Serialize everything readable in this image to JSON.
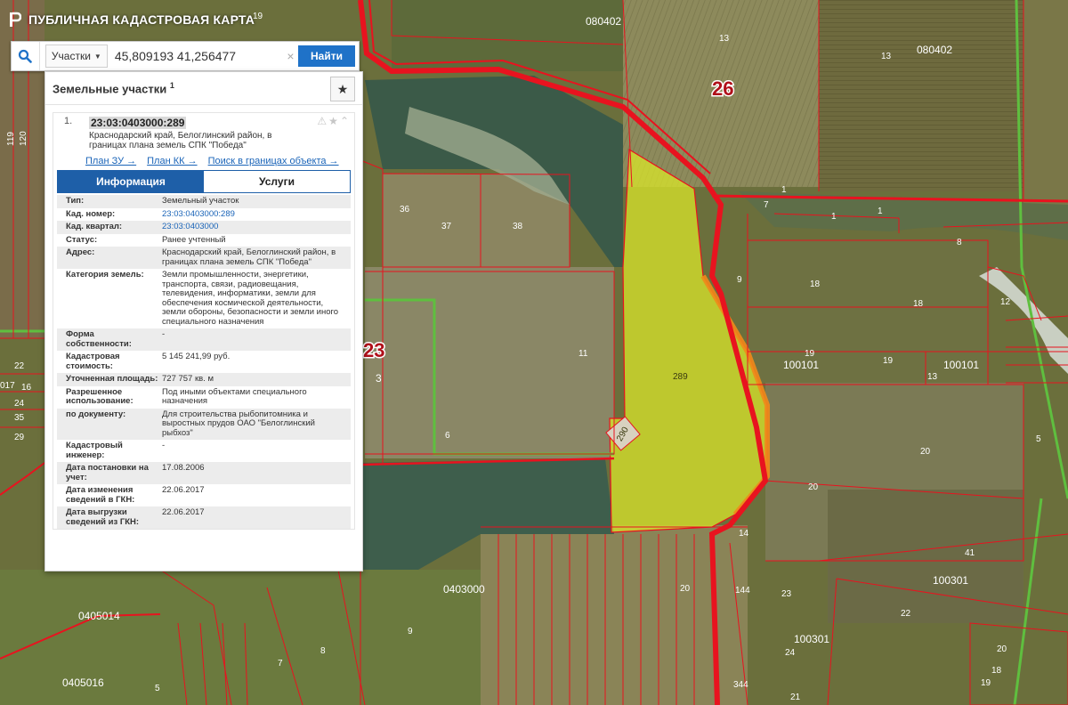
{
  "app": {
    "title": "ПУБЛИЧНАЯ КАДАСТРОВАЯ КАРТА"
  },
  "search": {
    "type_label": "Участки",
    "value": "45,809193 41,256477",
    "clear_symbol": "×",
    "button_label": "Найти"
  },
  "panel": {
    "title": "Земельные участки",
    "count": "1",
    "fav_symbol": "★",
    "result": {
      "index": "1.",
      "cad_number": "23:03:0403000:289",
      "address": "Краснодарский край, Белоглинский район, в границах плана земель СПК \"Победа\"",
      "icons": "⚠★⌃",
      "links": [
        "План ЗУ →",
        "План КК →",
        "Поиск в границах объекта →"
      ]
    },
    "tabs": [
      {
        "label": "Информация",
        "active": true
      },
      {
        "label": "Услуги",
        "active": false
      }
    ],
    "rows": [
      {
        "key": "Тип:",
        "value": "Земельный участок",
        "link": false
      },
      {
        "key": "Кад. номер:",
        "value": "23:03:0403000:289",
        "link": true
      },
      {
        "key": "Кад. квартал:",
        "value": "23:03:0403000",
        "link": true
      },
      {
        "key": "Статус:",
        "value": "Ранее учтенный",
        "link": false
      },
      {
        "key": "Адрес:",
        "value": "Краснодарский край, Белоглинский район, в границах плана земель СПК \"Победа\"",
        "link": false
      },
      {
        "key": "Категория земель:",
        "value": "Земли промышленности, энергетики, транспорта, связи, радиовещания, телевидения, информатики, земли для обеспечения космической деятельности, земли обороны, безопасности и земли иного специального назначения",
        "link": false
      },
      {
        "key": "Форма собственности:",
        "value": "-",
        "link": false
      },
      {
        "key": "Кадастровая стоимость:",
        "value": "5 145 241,99 руб.",
        "link": false
      },
      {
        "key": "Уточненная площадь:",
        "value": "727 757 кв. м",
        "link": false
      },
      {
        "key": "Разрешенное использование:",
        "value": "Под иными объектами специального назначения",
        "link": false
      },
      {
        "key": "по документу:",
        "value": "Для строительства рыбопитомника и выростных прудов ОАО \"Белоглинский рыбхоз\"",
        "link": false
      },
      {
        "key": "Кадастровый инженер:",
        "value": "-",
        "link": false
      },
      {
        "key": "Дата постановки на учет:",
        "value": "17.08.2006",
        "link": false
      },
      {
        "key": "Дата изменения сведений в ГКН:",
        "value": "22.06.2017",
        "link": false
      },
      {
        "key": "Дата выгрузки сведений из ГКН:",
        "value": "22.06.2017",
        "link": false
      }
    ]
  },
  "map": {
    "labels": {
      "l_19": "19",
      "l_080402a": "080402",
      "l_13a": "13",
      "l_13b": "13",
      "l_080402b": "080402",
      "l_26": "26",
      "l_36": "36",
      "l_37": "37",
      "l_38": "38",
      "l_1a": "1",
      "l_1b": "1",
      "l_1c": "1",
      "l_7": "7",
      "l_8": "8",
      "l_9": "9",
      "l_18a": "18",
      "l_18b": "18",
      "l_12": "12",
      "l_19b": "19",
      "l_19c": "19",
      "l_100101a": "100101",
      "l_100101b": "100101",
      "l_13c": "13",
      "l_23": "23",
      "l_3": "3",
      "l_11": "11",
      "l_289": "289",
      "l_290": "290",
      "l_6": "6",
      "l_20a": "20",
      "l_20b": "20",
      "l_14": "14",
      "l_5": "5",
      "l_41": "41",
      "l_100301a": "100301",
      "l_100301b": "100301",
      "l_22": "22",
      "l_0403000": "0403000",
      "l_144": "144",
      "l_20c": "20",
      "l_23b": "23",
      "l_24": "24",
      "l_0405014": "0405014",
      "l_0405016": "0405016",
      "l_9b": "9",
      "l_8b": "8",
      "l_7b": "7",
      "l_5b": "5",
      "l_344": "344",
      "l_21": "21",
      "l_20d": "20",
      "l_18c": "18",
      "l_19d": "19",
      "l_017": "017",
      "l_22b": "22",
      "l_16": "16",
      "l_24b": "24",
      "l_35": "35",
      "l_29": "29",
      "l_119": "119",
      "l_120": "120"
    },
    "colors": {
      "boundary": "#e8131f",
      "highlight": "#d9e62a",
      "green": "#5fbf3f",
      "water": "#3d5a48"
    }
  }
}
